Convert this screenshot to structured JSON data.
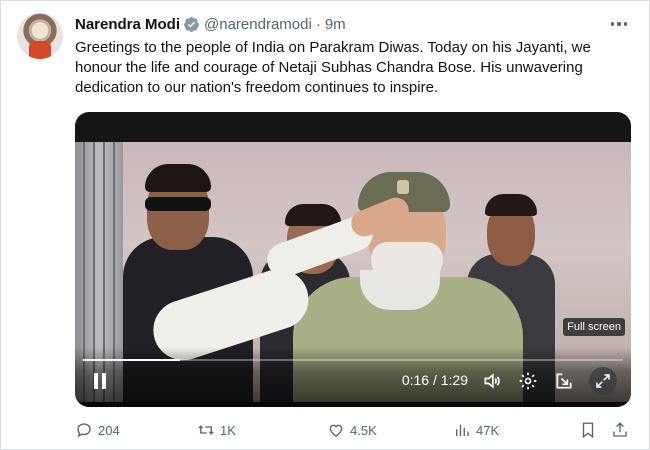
{
  "author": {
    "name": "Narendra Modi",
    "handle": "@narendramodi",
    "separator": "·",
    "time": "9m",
    "verified_icon": "verified-badge-icon",
    "accent_color": "#1d9bf0"
  },
  "tweet": {
    "text": "Greetings to the people of India on Parakram Diwas. Today on his Jayanti, we honour the life and courage of Netaji Subhas Chandra Bose. His unwavering dedication to our nation's freedom continues to inspire."
  },
  "video": {
    "current_time": "0:16",
    "duration": "1:29",
    "time_display": "0:16 / 1:29",
    "progress_fraction": 0.18,
    "tooltip": "Full screen"
  },
  "actions": {
    "replies": "204",
    "retweets": "1K",
    "likes": "4.5K",
    "views": "47K"
  }
}
